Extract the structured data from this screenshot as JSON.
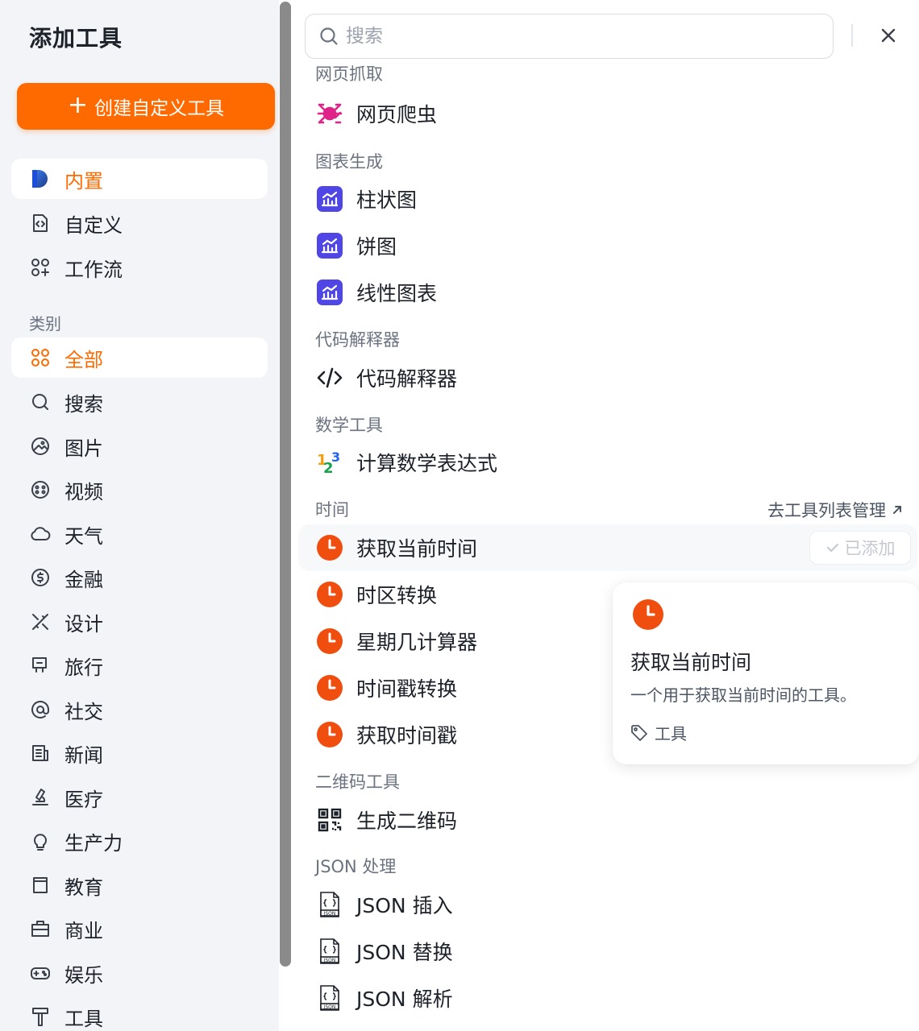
{
  "sidebar": {
    "title": "添加工具",
    "create_button": {
      "plus": "+",
      "label": "创建自定义工具"
    },
    "source_items": [
      {
        "label": "内置",
        "icon": "builtin-icon",
        "active": true
      },
      {
        "label": "自定义",
        "icon": "custom-code-icon",
        "active": false
      },
      {
        "label": "工作流",
        "icon": "workflow-icon",
        "active": false
      }
    ],
    "category_label": "类别",
    "categories": [
      {
        "label": "全部",
        "icon": "grid-icon",
        "active": true
      },
      {
        "label": "搜索",
        "icon": "search-icon"
      },
      {
        "label": "图片",
        "icon": "image-icon"
      },
      {
        "label": "视频",
        "icon": "video-icon"
      },
      {
        "label": "天气",
        "icon": "cloud-icon"
      },
      {
        "label": "金融",
        "icon": "dollar-icon"
      },
      {
        "label": "设计",
        "icon": "design-icon"
      },
      {
        "label": "旅行",
        "icon": "travel-icon"
      },
      {
        "label": "社交",
        "icon": "at-icon"
      },
      {
        "label": "新闻",
        "icon": "news-icon"
      },
      {
        "label": "医疗",
        "icon": "medical-icon"
      },
      {
        "label": "生产力",
        "icon": "lightbulb-icon"
      },
      {
        "label": "教育",
        "icon": "education-icon"
      },
      {
        "label": "商业",
        "icon": "briefcase-icon"
      },
      {
        "label": "娱乐",
        "icon": "gamepad-icon"
      },
      {
        "label": "工具",
        "icon": "hammer-icon"
      }
    ]
  },
  "search": {
    "placeholder": "搜索"
  },
  "main": {
    "groups": [
      {
        "heading": "网页抓取",
        "tools": [
          {
            "label": "网页爬虫",
            "icon": "spider-icon"
          }
        ]
      },
      {
        "heading": "图表生成",
        "tools": [
          {
            "label": "柱状图",
            "icon": "chart-icon"
          },
          {
            "label": "饼图",
            "icon": "chart-icon"
          },
          {
            "label": "线性图表",
            "icon": "chart-icon"
          }
        ]
      },
      {
        "heading": "代码解释器",
        "tools": [
          {
            "label": "代码解释器",
            "icon": "code-icon"
          }
        ]
      },
      {
        "heading": "数学工具",
        "tools": [
          {
            "label": "计算数学表达式",
            "icon": "math-icon"
          }
        ]
      },
      {
        "heading": "时间",
        "link": "去工具列表管理",
        "tools": [
          {
            "label": "获取当前时间",
            "icon": "clock-icon",
            "added_label": "已添加"
          },
          {
            "label": "时区转换",
            "icon": "clock-icon"
          },
          {
            "label": "星期几计算器",
            "icon": "clock-icon"
          },
          {
            "label": "时间戳转换",
            "icon": "clock-icon"
          },
          {
            "label": "获取时间戳",
            "icon": "clock-icon"
          }
        ]
      },
      {
        "heading": "二维码工具",
        "tools": [
          {
            "label": "生成二维码",
            "icon": "qrcode-icon"
          }
        ]
      },
      {
        "heading": "JSON 处理",
        "tools": [
          {
            "label": "JSON 插入",
            "icon": "json-file-icon"
          },
          {
            "label": "JSON 替换",
            "icon": "json-file-icon"
          },
          {
            "label": "JSON 解析",
            "icon": "json-file-icon"
          }
        ]
      }
    ]
  },
  "tooltip": {
    "title": "获取当前时间",
    "description": "一个用于获取当前时间的工具。",
    "tag": "工具"
  },
  "colors": {
    "accent": "#ff6a00",
    "clock": "#f04e0f",
    "chart": "#4f46e5",
    "spider": "#e0218a"
  }
}
